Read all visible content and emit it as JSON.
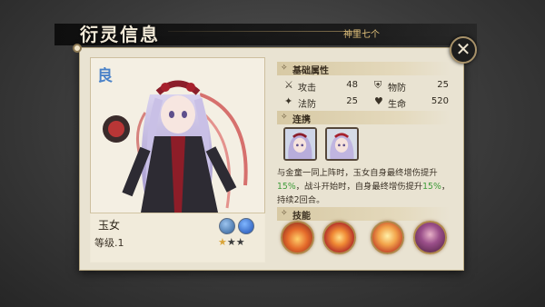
{
  "header": {
    "title": "衍灵信息",
    "tab_label": "神里七个",
    "close_label": "✕"
  },
  "card": {
    "rarity": "良",
    "name": "玉女",
    "level": "等级.1",
    "stars_filled": 1,
    "stars_total": 3,
    "star_glyph": "★"
  },
  "sections": {
    "attributes": {
      "title": "基础属性",
      "mark": "✧",
      "stats": [
        {
          "icon": "sword-icon",
          "glyph": "⚔",
          "label": "攻击",
          "value": "48"
        },
        {
          "icon": "shield-icon",
          "glyph": "⛨",
          "label": "物防",
          "value": "25"
        },
        {
          "icon": "magic-icon",
          "glyph": "✦",
          "label": "法防",
          "value": "25"
        },
        {
          "icon": "heart-icon",
          "glyph": "♥",
          "label": "生命",
          "value": "520"
        }
      ]
    },
    "link": {
      "title": "连携",
      "mark": "✧",
      "description": {
        "p1": "与金童一同上阵时，玉女自身最终增伤提升",
        "h1": "15%",
        "p2": "，战斗开始时，自身最终增伤提升",
        "h2": "15%",
        "p3": "，持续2回合。"
      }
    },
    "skills": {
      "title": "技能",
      "mark": "✧",
      "items": [
        {
          "name": "skill-fire-strike"
        },
        {
          "name": "skill-ring-flame"
        },
        {
          "name": "skill-hand-burst"
        },
        {
          "name": "skill-character-rage"
        }
      ]
    }
  },
  "colors": {
    "highlight": "#3f9c3a",
    "panel": "#e9e3d2",
    "accent_gold": "#e2c27c"
  }
}
